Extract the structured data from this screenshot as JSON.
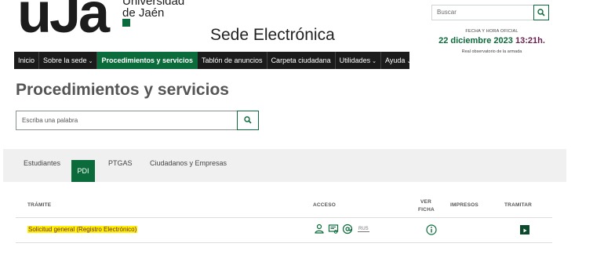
{
  "header": {
    "logo_text": "uJa",
    "university_line1": "Universidad",
    "university_line2": "de Jaén",
    "site_title": "Sede Electrónica",
    "search_placeholder": "Buscar",
    "date_label": "FECHA Y HORA OFICIAL",
    "date_value": "22 diciembre 2023",
    "time_value": "13:21h.",
    "observatory": "Real observatorio de la armada"
  },
  "nav": {
    "items": [
      {
        "label": "Inicio",
        "has_caret": false
      },
      {
        "label": "Sobre la sede",
        "has_caret": true
      },
      {
        "label": "Procedimientos y servicios",
        "has_caret": false,
        "active": true
      },
      {
        "label": "Tablón de anuncios",
        "has_caret": false
      },
      {
        "label": "Carpeta ciudadana",
        "has_caret": false
      },
      {
        "label": "Utilidades",
        "has_caret": true
      },
      {
        "label": "Ayuda",
        "has_caret": true
      }
    ],
    "caret_glyph": "⌄"
  },
  "page": {
    "title": "Procedimientos y servicios",
    "search_placeholder": "Escriba una palabra"
  },
  "tabs": {
    "items": [
      "Estudiantes",
      "PDI",
      "PTGAS",
      "Ciudadanos y Empresas"
    ],
    "active": "PDI"
  },
  "table": {
    "headers": {
      "tramite": "TRÁMITE",
      "acceso": "ACCESO",
      "ver_ficha_1": "VER",
      "ver_ficha_2": "FICHA",
      "impresos": "IMPRESOS",
      "tramitar": "TRAMITAR"
    },
    "rows": [
      {
        "name": "Solicitud general (Registro Electrónico)",
        "access_icons": [
          "user-key-icon",
          "certificate-icon",
          "at-sign-icon"
        ],
        "access_rus": "RUS",
        "ficha_icon": "info-icon",
        "tramitar_icon": "play-icon"
      }
    ]
  },
  "colors": {
    "brand_green": "#0b6b3a",
    "nav_dark": "#1b1b1b",
    "highlight": "#fff200",
    "time_purple": "#6a1f4e"
  }
}
